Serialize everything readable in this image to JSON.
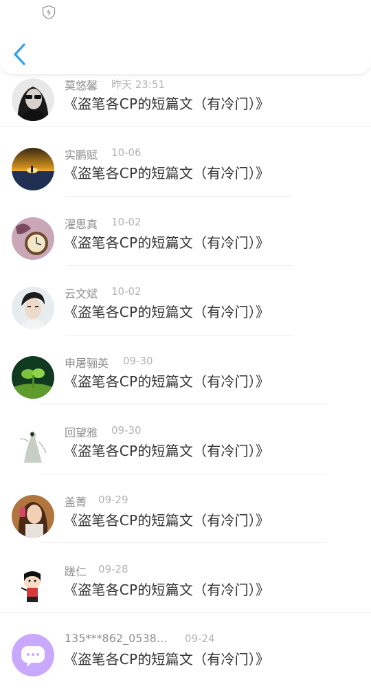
{
  "header": {
    "status_icon": "shield-lightning-icon",
    "back_icon": "chevron-left-icon",
    "accent_color": "#2aa3ef"
  },
  "messages": [
    {
      "name": "莫悠馨",
      "time": "昨天 23:51",
      "text": "《盗笔各CP的短篇文（有冷门）》",
      "avatar": "girl-sunglasses-photo"
    },
    {
      "name": "实鹏赋",
      "time": "10-06",
      "text": "《盗笔各CP的短篇文（有冷门）》",
      "avatar": "sunset-sea-photo"
    },
    {
      "name": "濯思真",
      "time": "10-02",
      "text": "《盗笔各CP的短篇文（有冷门）》",
      "avatar": "pocket-watch-photo"
    },
    {
      "name": "云文斌",
      "time": "10-02",
      "text": "《盗笔各CP的短篇文（有冷门）》",
      "avatar": "young-man-photo"
    },
    {
      "name": "申屠骊英",
      "time": "09-30",
      "text": "《盗笔各CP的短篇文（有冷门）》",
      "avatar": "green-sprout-photo"
    },
    {
      "name": "回望雅",
      "time": "09-30",
      "text": "《盗笔各CP的短篇文（有冷门）》",
      "avatar": "ink-painting-figure"
    },
    {
      "name": "盖菁",
      "time": "09-29",
      "text": "《盗笔各CP的短篇文（有冷门）》",
      "avatar": "selfie-girl-photo"
    },
    {
      "name": "蹉仁",
      "time": "09-28",
      "text": "《盗笔各CP的短篇文（有冷门）》",
      "avatar": "cartoon-boy-drawing"
    },
    {
      "name": "135***862_0538…",
      "time": "09-24",
      "text": "《盗笔各CP的短篇文（有冷门）》",
      "avatar": "default-purple-chat-avatar"
    }
  ]
}
